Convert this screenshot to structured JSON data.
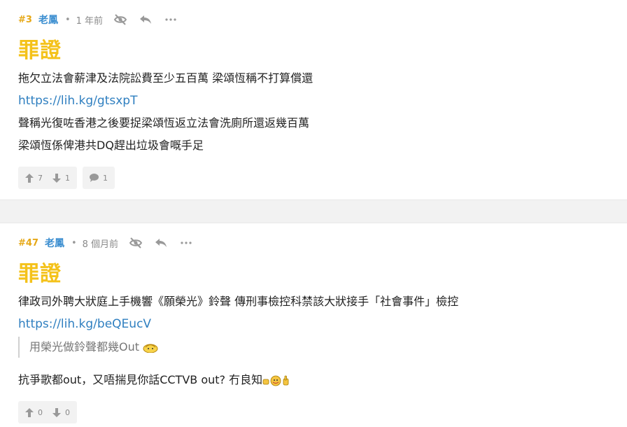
{
  "posts": [
    {
      "floor": "#3",
      "author": "老鳳",
      "time": "1 年前",
      "title": "罪證",
      "lines": [
        "拖欠立法會薪津及法院訟費至少五百萬 梁頌恆稱不打算償還",
        "聲稱光復咗香港之後要捉梁頌恆返立法會洗廁所還返幾百萬",
        "梁頌恆係俾港共DQ趕出垃圾會嘅手足"
      ],
      "link": "https://lih.kg/gtsxpT",
      "upvotes": "7",
      "downvotes": "1",
      "comments": "1"
    },
    {
      "floor": "#47",
      "author": "老鳳",
      "time": "8 個月前",
      "title": "罪證",
      "lines": [
        "律政司外聘大狀庭上手機響《願榮光》鈴聲 傳刑事檢控科禁該大狀接手「社會事件」檢控",
        "抗爭歌都out，又唔揣見你話CCTVB out? 冇良知"
      ],
      "link": "https://lih.kg/beQEucV",
      "quote": "用榮光做鈴聲都幾Out",
      "upvotes": "0",
      "downvotes": "0"
    }
  ],
  "icons": {
    "hide": "eye-slash-icon",
    "reply": "reply-icon",
    "more": "ellipsis-icon",
    "up": "thumb-up-arrow-icon",
    "down": "thumb-down-arrow-icon",
    "comment": "comment-icon"
  },
  "colors": {
    "floor": "#e6a817",
    "author": "#3b8ed0",
    "title": "#f4c21a",
    "link": "#2f7fc0"
  }
}
